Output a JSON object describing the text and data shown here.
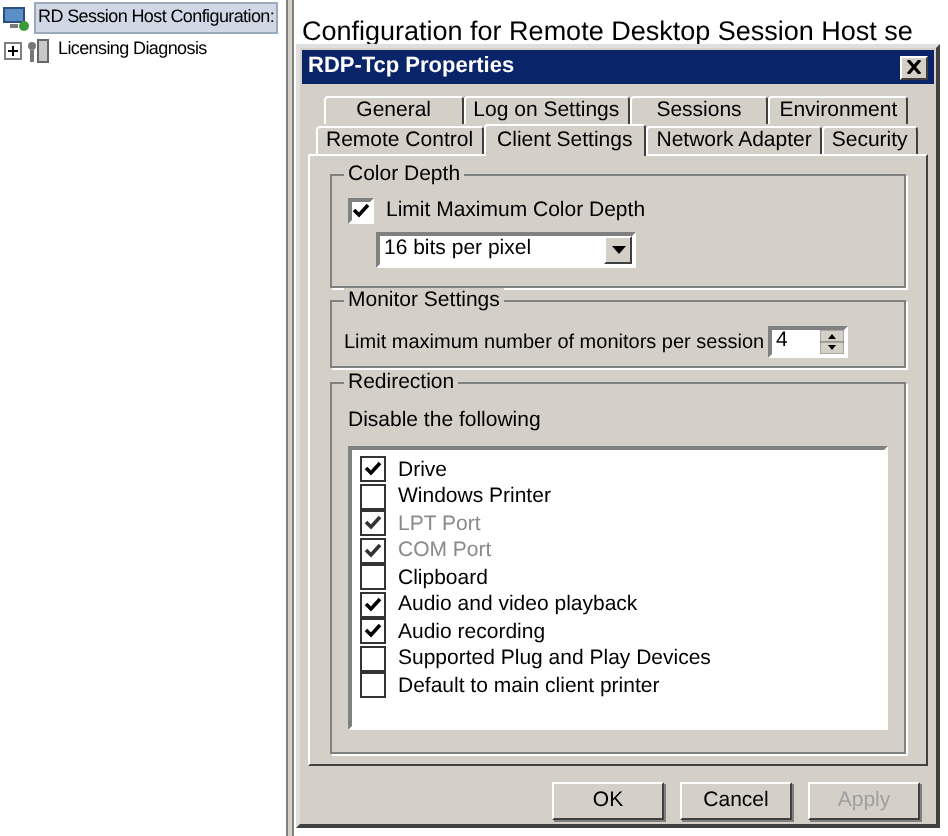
{
  "tree": [
    {
      "label": "RD Session Host Configuration:",
      "selected": true
    },
    {
      "label": "Licensing Diagnosis",
      "selected": false,
      "expanded": false
    }
  ],
  "heading": "Configuration for Remote Desktop Session Host se",
  "dialog": {
    "title": "RDP-Tcp Properties",
    "tab_rows": [
      [
        {
          "label": "General",
          "selected": false
        },
        {
          "label": "Log on Settings",
          "selected": false
        },
        {
          "label": "Sessions",
          "selected": false
        },
        {
          "label": "Environment",
          "selected": false
        }
      ],
      [
        {
          "label": "Remote Control",
          "selected": false
        },
        {
          "label": "Client Settings",
          "selected": true
        },
        {
          "label": "Network Adapter",
          "selected": false
        },
        {
          "label": "Security",
          "selected": false
        }
      ]
    ],
    "color_depth": {
      "title": "Color Depth",
      "checkbox": {
        "label": "Limit Maximum Color Depth",
        "checked": true
      },
      "dropdown": "16 bits per pixel"
    },
    "monitor_settings": {
      "title": "Monitor Settings",
      "label": "Limit maximum number of monitors per session",
      "value": "4"
    },
    "redirection": {
      "title": "Redirection",
      "label": "Disable the following",
      "items": [
        {
          "label": "Drive",
          "checked": true,
          "disabled": false
        },
        {
          "label": "Windows Printer",
          "checked": false,
          "disabled": false
        },
        {
          "label": "LPT Port",
          "checked": true,
          "disabled": true
        },
        {
          "label": "COM Port",
          "checked": true,
          "disabled": true
        },
        {
          "label": "Clipboard",
          "checked": false,
          "disabled": false
        },
        {
          "label": "Audio and video playback",
          "checked": true,
          "disabled": false
        },
        {
          "label": "Audio recording",
          "checked": true,
          "disabled": false
        },
        {
          "label": "Supported Plug and Play Devices",
          "checked": false,
          "disabled": false
        },
        {
          "label": "Default to main client printer",
          "checked": false,
          "disabled": false
        }
      ]
    },
    "buttons": [
      {
        "label": "OK",
        "disabled": false
      },
      {
        "label": "Cancel",
        "disabled": false
      },
      {
        "label": "Apply",
        "disabled": true
      }
    ]
  }
}
